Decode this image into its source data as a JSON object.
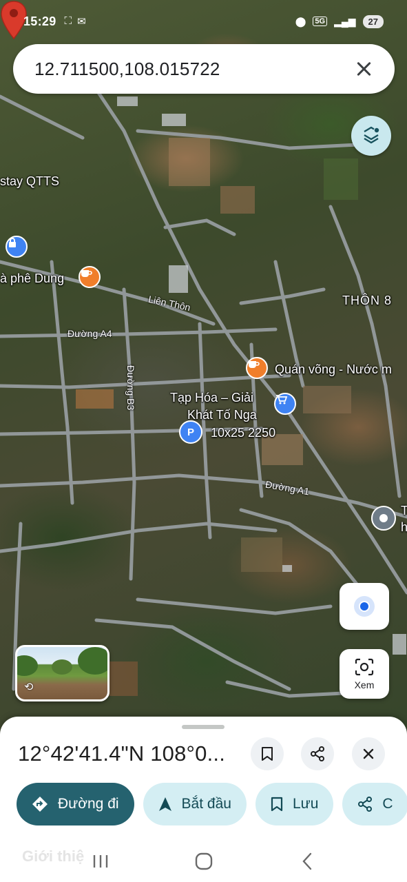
{
  "status_bar": {
    "time": "15:29",
    "network": "5G",
    "battery": "27"
  },
  "search": {
    "query": "12.711500,108.015722"
  },
  "map": {
    "labels": {
      "stay": "stay QTTS",
      "cafe_dung": "à phê Dung",
      "thon8": "THÔN 8",
      "quan_vong": "Quán võng - Nước m",
      "tap_hoa_line1": "Tạp Hóa – Giải",
      "tap_hoa_line2": "Khát Tố Nga",
      "parking": "10x25 2250",
      "edge_poi_line1": "T",
      "edge_poi_line2": "h"
    },
    "roads": {
      "lien_thon": "Liên Thôn",
      "duong_a4": "Đường A4",
      "duong_b3": "Đường B3",
      "duong_a1": "Đường A1"
    }
  },
  "controls": {
    "lens_label": "Xem"
  },
  "sheet": {
    "coordinates": "12°42'41.4\"N 108°0...",
    "chips": {
      "directions": "Đường đi",
      "start": "Bắt đầu",
      "save": "Lưu",
      "share": "C"
    },
    "hint": "Giới thiệ"
  },
  "colors": {
    "primary_chip": "#25626f",
    "secondary_chip": "#d4eef3",
    "pin": "#d93a2b",
    "location_dot": "#1a66e8"
  }
}
